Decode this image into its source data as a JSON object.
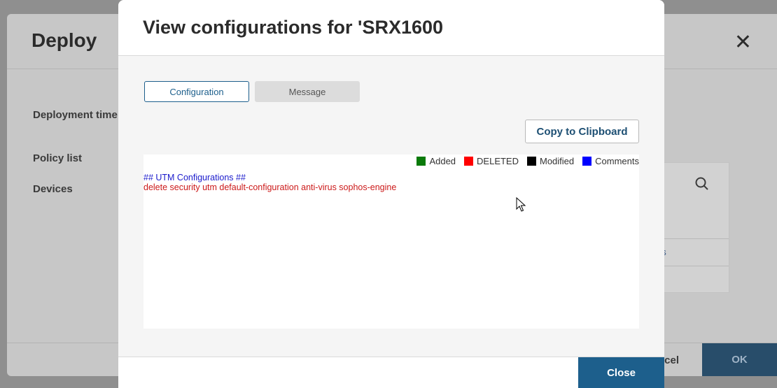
{
  "background_dialog": {
    "title": "Deploy",
    "close_glyph": "✕",
    "labels": [
      "Deployment time",
      "Policy list",
      "Devices"
    ],
    "partial_link": "ns",
    "cancel_label": "ncel",
    "ok_label": "OK"
  },
  "modal": {
    "title": "View configurations for 'SRX1600",
    "tabs": [
      {
        "label": "Configuration",
        "selected": true
      },
      {
        "label": "Message",
        "selected": false
      }
    ],
    "copy_button": "Copy to Clipboard",
    "legend": [
      {
        "label": "Added",
        "color": "#0a7a0a"
      },
      {
        "label": "DELETED",
        "color": "#ff0000"
      },
      {
        "label": "Modified",
        "color": "#000000"
      },
      {
        "label": "Comments",
        "color": "#0000ff"
      }
    ],
    "config_lines": [
      {
        "text": "## UTM Configurations ##",
        "kind": "comment"
      },
      {
        "text": "delete security utm default-configuration anti-virus sophos-engine",
        "kind": "deleted"
      }
    ],
    "close_button": "Close"
  },
  "icons": {
    "close": "close-icon",
    "search": "search-icon",
    "cursor": "mouse-pointer-icon"
  }
}
